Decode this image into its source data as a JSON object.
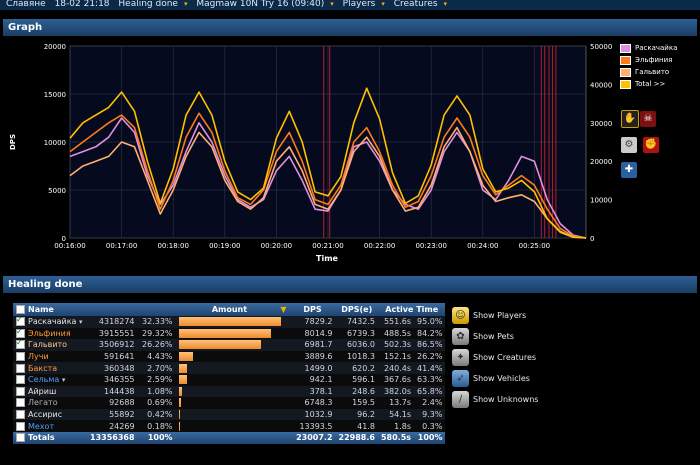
{
  "topbar": {
    "items": [
      "Славяне",
      "18-02 21:18",
      "Healing done",
      "Magmaw 10N Try 16 (09:40)",
      "Players",
      "Creatures"
    ],
    "arrows": [
      "",
      "",
      "▾",
      "▾",
      "▾",
      "▾"
    ]
  },
  "graph": {
    "title": "Graph",
    "xlabel": "Time",
    "ylabel": "DPS"
  },
  "chart_data": {
    "type": "line",
    "x_ticks": [
      "00:16:00",
      "00:17:00",
      "00:18:00",
      "00:19:00",
      "00:20:00",
      "00:21:00",
      "00:22:00",
      "00:23:00",
      "00:24:00",
      "00:25:00"
    ],
    "y_left_ticks": [
      0,
      5000,
      10000,
      15000,
      20000
    ],
    "y_right_ticks": [
      0,
      10000,
      20000,
      30000,
      40000,
      50000
    ],
    "ylim_left": [
      0,
      20000
    ],
    "ylim_right": [
      0,
      50000
    ],
    "x_range_seconds": [
      960,
      1560
    ],
    "markers_seconds": [
      1255,
      1262,
      1508,
      1512,
      1517,
      1521,
      1525
    ],
    "grid": true,
    "series": [
      {
        "name": "Раскачайка",
        "color": "#e090e0",
        "axis": "left",
        "x": [
          960,
          975,
          990,
          1005,
          1020,
          1035,
          1050,
          1065,
          1080,
          1095,
          1110,
          1125,
          1140,
          1155,
          1170,
          1185,
          1200,
          1215,
          1230,
          1245,
          1260,
          1275,
          1290,
          1305,
          1320,
          1335,
          1350,
          1365,
          1380,
          1395,
          1410,
          1425,
          1440,
          1455,
          1470,
          1485,
          1500,
          1515,
          1530,
          1545,
          1560
        ],
        "values": [
          8500,
          9000,
          9500,
          10500,
          12500,
          11000,
          6500,
          3500,
          5500,
          9000,
          12000,
          10000,
          6500,
          4000,
          3200,
          4000,
          7000,
          8500,
          6000,
          3000,
          2800,
          5000,
          9500,
          10000,
          8000,
          5000,
          3500,
          3000,
          5000,
          9000,
          11000,
          9000,
          5000,
          4000,
          6000,
          8500,
          8000,
          4000,
          1500,
          300,
          0
        ]
      },
      {
        "name": "Эльфиния",
        "color": "#ff7a1a",
        "axis": "left",
        "x": [
          960,
          975,
          990,
          1005,
          1020,
          1035,
          1050,
          1065,
          1080,
          1095,
          1110,
          1125,
          1140,
          1155,
          1170,
          1185,
          1200,
          1215,
          1230,
          1245,
          1260,
          1275,
          1290,
          1305,
          1320,
          1335,
          1350,
          1365,
          1380,
          1395,
          1410,
          1425,
          1440,
          1455,
          1470,
          1485,
          1500,
          1515,
          1530,
          1545,
          1560
        ],
        "values": [
          9000,
          10000,
          11000,
          12000,
          12800,
          11500,
          7000,
          3000,
          6000,
          10500,
          13000,
          11000,
          7000,
          4200,
          3500,
          5000,
          9000,
          11000,
          8000,
          4000,
          3500,
          5500,
          10000,
          11500,
          9000,
          5500,
          3200,
          3800,
          6500,
          10500,
          12500,
          10500,
          6500,
          4500,
          5500,
          6500,
          5500,
          3000,
          1000,
          200,
          0
        ]
      },
      {
        "name": "Гальвито",
        "color": "#ffb070",
        "axis": "left",
        "x": [
          960,
          975,
          990,
          1005,
          1020,
          1035,
          1050,
          1065,
          1080,
          1095,
          1110,
          1125,
          1140,
          1155,
          1170,
          1185,
          1200,
          1215,
          1230,
          1245,
          1260,
          1275,
          1290,
          1305,
          1320,
          1335,
          1350,
          1365,
          1380,
          1395,
          1410,
          1425,
          1440,
          1455,
          1470,
          1485,
          1500,
          1515,
          1530,
          1545,
          1560
        ],
        "values": [
          6500,
          7500,
          8000,
          8500,
          10000,
          9500,
          6000,
          2500,
          5000,
          8500,
          11000,
          9500,
          6000,
          3800,
          3000,
          4200,
          8000,
          9500,
          7000,
          3500,
          3000,
          5000,
          9000,
          10500,
          8500,
          5000,
          2800,
          3200,
          5500,
          9500,
          11500,
          9000,
          5500,
          3800,
          4200,
          4500,
          3800,
          2000,
          700,
          100,
          0
        ]
      },
      {
        "name": "Total >>",
        "color": "#ffc000",
        "axis": "right",
        "x": [
          960,
          975,
          990,
          1005,
          1020,
          1035,
          1050,
          1065,
          1080,
          1095,
          1110,
          1125,
          1140,
          1155,
          1170,
          1185,
          1200,
          1215,
          1230,
          1245,
          1260,
          1275,
          1290,
          1305,
          1320,
          1335,
          1350,
          1365,
          1380,
          1395,
          1410,
          1425,
          1440,
          1455,
          1470,
          1485,
          1500,
          1515,
          1530,
          1545,
          1560
        ],
        "values": [
          26000,
          30000,
          32000,
          34000,
          38000,
          33000,
          20000,
          9000,
          18000,
          32000,
          38000,
          32000,
          20000,
          12000,
          10000,
          13000,
          26000,
          33000,
          25000,
          12000,
          11000,
          16000,
          30000,
          39000,
          31000,
          17000,
          9000,
          11000,
          19000,
          32000,
          37000,
          32000,
          18000,
          12000,
          13000,
          15000,
          12000,
          5000,
          1500,
          200,
          0
        ]
      }
    ]
  },
  "graph_icons": [
    "hand-icon",
    "skull-icon",
    "gear-icon",
    "flex-icon",
    "cross-icon"
  ],
  "healing": {
    "title": "Healing done",
    "headers": [
      "Name",
      "Amount",
      "DPS",
      "DPS(e)",
      "Active Time"
    ],
    "rows": [
      {
        "name": "Раскачайка",
        "color": "#e6e6e6",
        "checked": true,
        "dropdown": true,
        "amount": "4318274",
        "pct": "32.33%",
        "bar": 1.0,
        "dps": "7829.2",
        "dpse": "7432.5",
        "time": "551.6s",
        "tpct": "95.0%"
      },
      {
        "name": "Эльфиния",
        "color": "#ff9a3a",
        "checked": true,
        "dropdown": false,
        "amount": "3915551",
        "pct": "29.32%",
        "bar": 0.907,
        "dps": "8014.9",
        "dpse": "6739.3",
        "time": "488.5s",
        "tpct": "84.2%"
      },
      {
        "name": "Гальвито",
        "color": "#ffc890",
        "checked": true,
        "dropdown": false,
        "amount": "3506912",
        "pct": "26.26%",
        "bar": 0.812,
        "dps": "6981.7",
        "dpse": "6036.0",
        "time": "502.3s",
        "tpct": "86.5%"
      },
      {
        "name": "Лучи",
        "color": "#ff9a3a",
        "checked": false,
        "dropdown": false,
        "amount": "591641",
        "pct": "4.43%",
        "bar": 0.137,
        "dps": "3889.6",
        "dpse": "1018.3",
        "time": "152.1s",
        "tpct": "26.2%"
      },
      {
        "name": "Бакста",
        "color": "#ff9a3a",
        "checked": false,
        "dropdown": false,
        "amount": "360348",
        "pct": "2.70%",
        "bar": 0.083,
        "dps": "1499.0",
        "dpse": "620.2",
        "time": "240.4s",
        "tpct": "41.4%"
      },
      {
        "name": "Сельма",
        "color": "#4aa0ff",
        "checked": false,
        "dropdown": true,
        "amount": "346355",
        "pct": "2.59%",
        "bar": 0.08,
        "dps": "942.1",
        "dpse": "596.1",
        "time": "367.6s",
        "tpct": "63.3%"
      },
      {
        "name": "Айриш",
        "color": "#e6e6e6",
        "checked": false,
        "dropdown": false,
        "amount": "144438",
        "pct": "1.08%",
        "bar": 0.033,
        "dps": "378.1",
        "dpse": "248.6",
        "time": "382.0s",
        "tpct": "65.8%"
      },
      {
        "name": "Легато",
        "color": "#b0b0b0",
        "checked": false,
        "dropdown": false,
        "amount": "92688",
        "pct": "0.69%",
        "bar": 0.021,
        "dps": "6748.3",
        "dpse": "159.5",
        "time": "13.7s",
        "tpct": "2.4%"
      },
      {
        "name": "Ассирис",
        "color": "#e6e6e6",
        "checked": false,
        "dropdown": false,
        "amount": "55892",
        "pct": "0.42%",
        "bar": 0.013,
        "dps": "1032.9",
        "dpse": "96.2",
        "time": "54.1s",
        "tpct": "9.3%"
      },
      {
        "name": "Мехот",
        "color": "#4aa0ff",
        "checked": false,
        "dropdown": false,
        "amount": "24269",
        "pct": "0.18%",
        "bar": 0.006,
        "dps": "13393.5",
        "dpse": "41.8",
        "time": "1.8s",
        "tpct": "0.3%"
      }
    ],
    "totals": {
      "name": "Totals",
      "amount": "13356368",
      "pct": "100%",
      "dps": "23007.2",
      "dpse": "22988.6",
      "time": "580.5s",
      "tpct": "100%"
    }
  },
  "side_options": [
    {
      "label": "Show Players",
      "icon": "player-icon"
    },
    {
      "label": "Show Pets",
      "icon": "pet-icon"
    },
    {
      "label": "Show Creatures",
      "icon": "creature-icon"
    },
    {
      "label": "Show Vehicles",
      "icon": "vehicle-icon"
    },
    {
      "label": "Show Unknowns",
      "icon": "unknown-icon"
    }
  ]
}
